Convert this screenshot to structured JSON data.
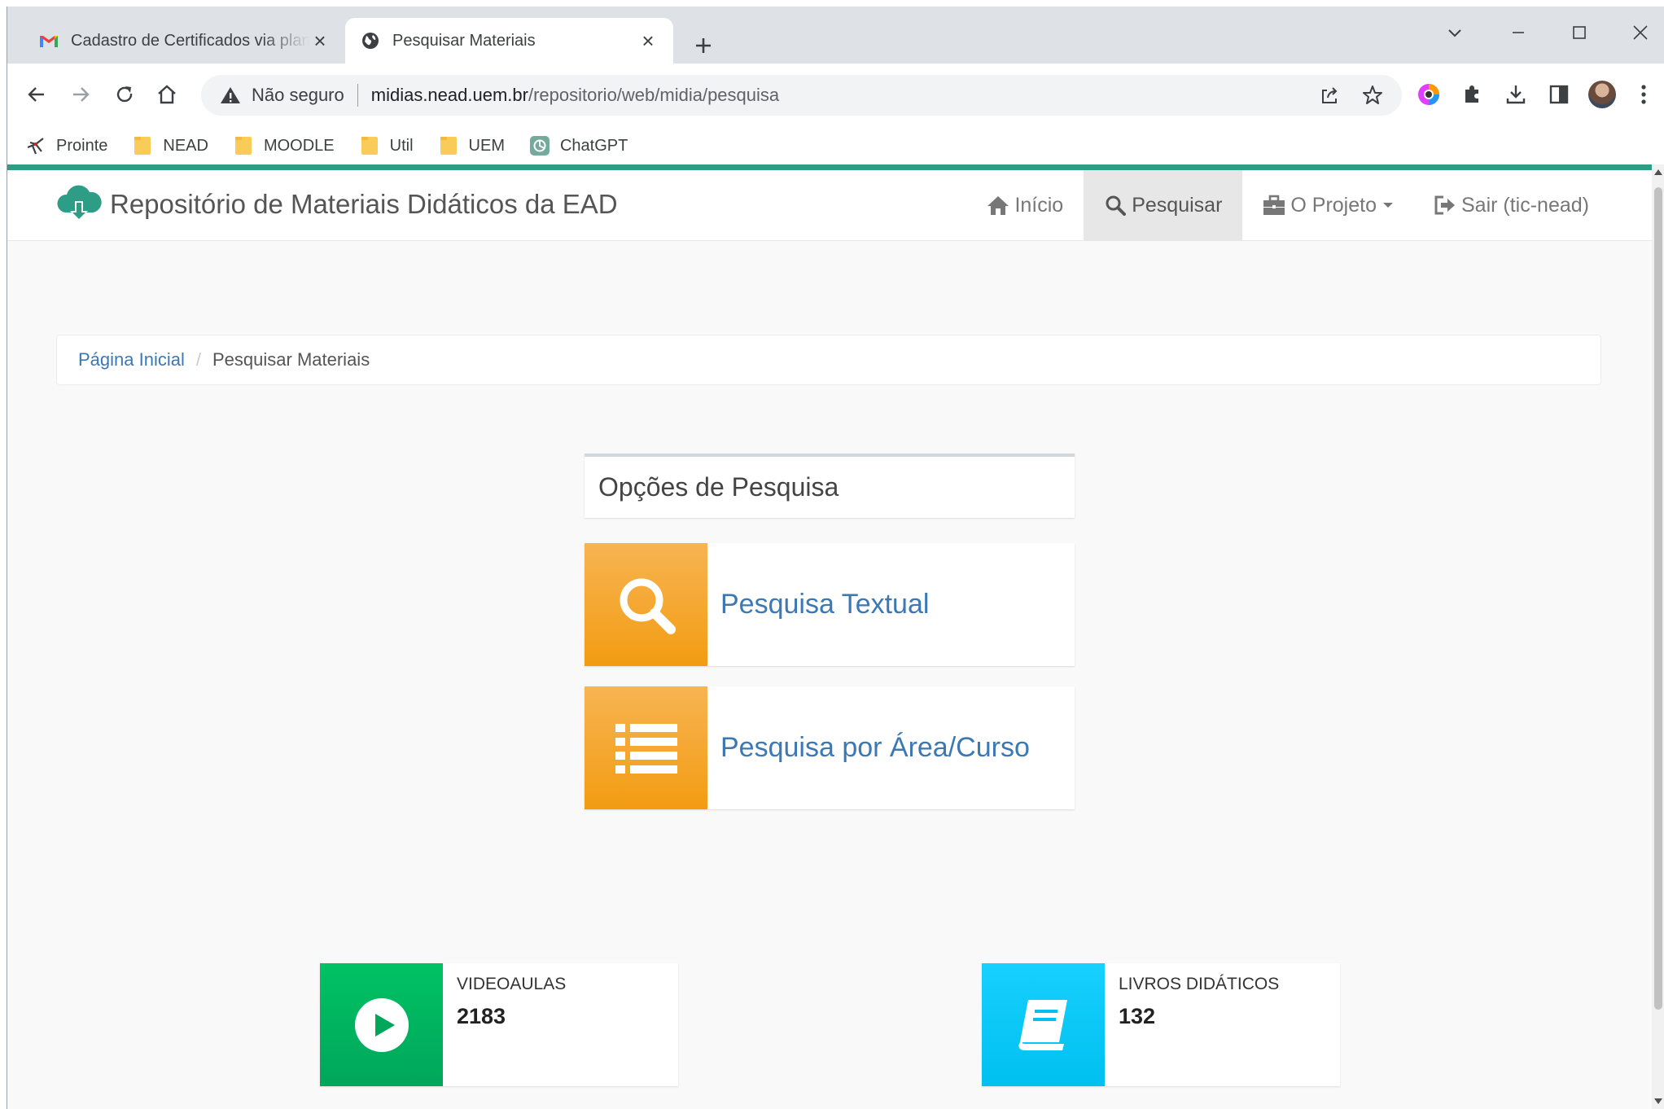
{
  "browser": {
    "tabs": [
      {
        "title": "Cadastro de Certificados via planilha",
        "favicon": "gmail-icon",
        "active": false
      },
      {
        "title": "Pesquisar Materiais",
        "favicon": "globe-icon",
        "active": true
      }
    ],
    "address": {
      "security_label": "Não seguro",
      "url_host": "midias.nead.uem.br",
      "url_path": "/repositorio/web/midia/pesquisa"
    },
    "bookmarks": [
      {
        "label": "Prointe",
        "icon": "prointe-icon"
      },
      {
        "label": "NEAD",
        "icon": "folder-icon"
      },
      {
        "label": "MOODLE",
        "icon": "folder-icon"
      },
      {
        "label": "Util",
        "icon": "folder-icon"
      },
      {
        "label": "UEM",
        "icon": "folder-icon"
      },
      {
        "label": "ChatGPT",
        "icon": "chatgpt-icon"
      }
    ]
  },
  "site": {
    "brand": "Repositório de Materiais Didáticos da EAD",
    "nav": [
      {
        "label": "Início",
        "icon": "home-icon",
        "active": false
      },
      {
        "label": "Pesquisar",
        "icon": "search-icon",
        "active": true
      },
      {
        "label": "O Projeto",
        "icon": "briefcase-icon",
        "active": false,
        "dropdown": true
      },
      {
        "label": "Sair (tic-nead)",
        "icon": "logout-icon",
        "active": false
      }
    ],
    "breadcrumb": {
      "home": "Página Inicial",
      "current": "Pesquisar Materiais"
    },
    "search_panel": {
      "title": "Opções de Pesquisa",
      "options": [
        {
          "label": "Pesquisa Textual",
          "icon": "search-icon"
        },
        {
          "label": "Pesquisa por Área/Curso",
          "icon": "list-icon"
        }
      ]
    },
    "stats": [
      {
        "label": "VIDEOAULAS",
        "value": "2183",
        "icon": "play-circle-icon",
        "color": "#00a65a"
      },
      {
        "label": "LIVROS DIDÁTICOS",
        "value": "132",
        "icon": "book-icon",
        "color": "#00c0ef"
      }
    ]
  },
  "colors": {
    "accent_line": "#2e9d85",
    "option_orange": "#f39c12",
    "link_blue": "#3c78b4"
  }
}
